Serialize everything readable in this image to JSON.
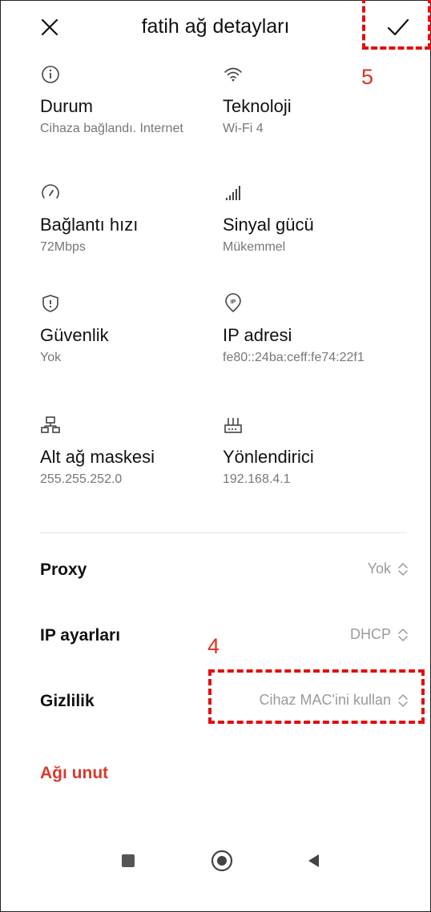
{
  "header": {
    "title": "fatih ağ detayları",
    "close_icon": "close-icon",
    "confirm_icon": "checkmark-icon"
  },
  "annotations": {
    "confirm_number": "5",
    "privacy_number": "4",
    "color": "#e01010"
  },
  "details": [
    {
      "icon": "info-icon",
      "label": "Durum",
      "value": "Cihaza bağlandı. İnternet"
    },
    {
      "icon": "wifi-icon",
      "label": "Teknoloji",
      "value": "Wi-Fi 4"
    },
    {
      "icon": "speedometer-icon",
      "label": "Bağlantı hızı",
      "value": "72Mbps"
    },
    {
      "icon": "signal-bars-icon",
      "label": "Sinyal gücü",
      "value": "Mükemmel"
    },
    {
      "icon": "shield-icon",
      "label": "Güvenlik",
      "value": "Yok"
    },
    {
      "icon": "ip-pin-icon",
      "label": "IP adresi",
      "value": "fe80::24ba:ceff:fe74:22f1"
    },
    {
      "icon": "network-tree-icon",
      "label": "Alt ağ maskesi",
      "value": "255.255.252.0"
    },
    {
      "icon": "router-icon",
      "label": "Yönlendirici",
      "value": "192.168.4.1"
    }
  ],
  "settings": {
    "proxy": {
      "label": "Proxy",
      "value": "Yok"
    },
    "ip_settings": {
      "label": "IP ayarları",
      "value": "DHCP"
    },
    "privacy": {
      "label": "Gizlilik",
      "value": "Cihaz MAC'ini kullan"
    }
  },
  "forget_network": "Ağı unut",
  "colors": {
    "accent_red": "#d83a2c",
    "secondary_text": "#777777",
    "value_text": "#9a9a9a"
  }
}
